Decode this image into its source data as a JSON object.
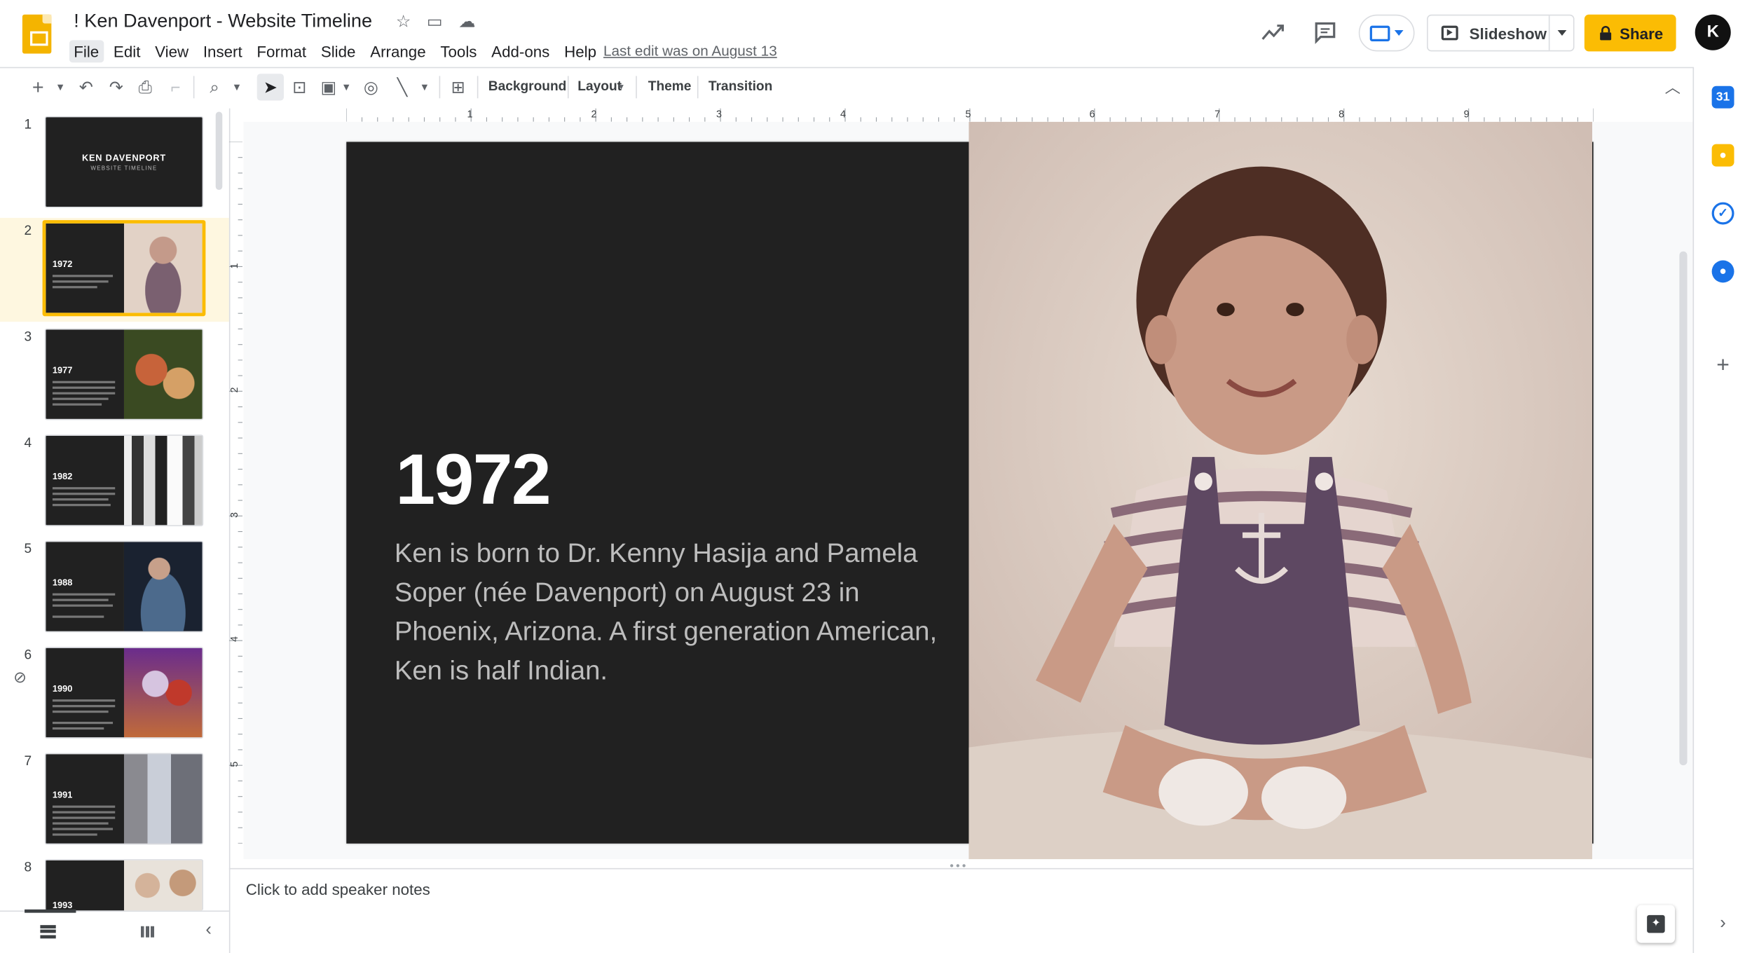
{
  "header": {
    "title": "! Ken Davenport - Website Timeline",
    "menu": [
      "File",
      "Edit",
      "View",
      "Insert",
      "Format",
      "Slide",
      "Arrange",
      "Tools",
      "Add-ons",
      "Help"
    ],
    "last_edit": "Last edit was on August 13",
    "slideshow_label": "Slideshow",
    "share_label": "Share",
    "avatar_text": "K"
  },
  "toolbar": {
    "background_label": "Background",
    "layout_label": "Layout",
    "theme_label": "Theme",
    "transition_label": "Transition"
  },
  "filmstrip": {
    "slides": [
      {
        "num": "1",
        "title": "KEN DAVENPORT",
        "subtitle": "WEBSITE TIMELINE"
      },
      {
        "num": "2",
        "year": "1972"
      },
      {
        "num": "3",
        "year": "1977"
      },
      {
        "num": "4",
        "year": "1982"
      },
      {
        "num": "5",
        "year": "1988"
      },
      {
        "num": "6",
        "year": "1990"
      },
      {
        "num": "7",
        "year": "1991"
      },
      {
        "num": "8",
        "year": "1993"
      }
    ],
    "selected": "2"
  },
  "ruler": {
    "h": [
      "1",
      "2",
      "3",
      "4",
      "5",
      "6",
      "7",
      "8",
      "9"
    ],
    "v": [
      "1",
      "2",
      "3",
      "4",
      "5"
    ]
  },
  "slide": {
    "year": "1972",
    "description": "Ken is born to Dr. Kenny Hasija and Pamela Soper (née Davenport) on August 23 in Phoenix, Arizona. A first generation American, Ken is half Indian."
  },
  "notes": {
    "placeholder": "Click to add speaker notes"
  },
  "colors": {
    "accent": "#fbbc04",
    "slide_bg": "#212121",
    "selection": "#fbbc04"
  }
}
